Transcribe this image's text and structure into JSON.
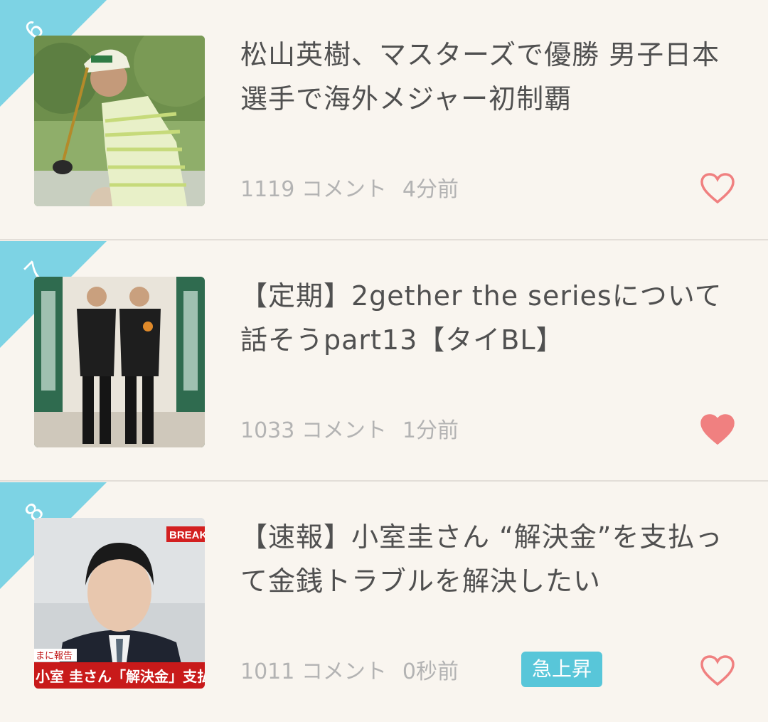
{
  "colors": {
    "accent": "#7dd3e4",
    "heart": "#f08080",
    "badge": "#58c6d9",
    "meta_text": "#b3b3b3",
    "title_text": "#505050"
  },
  "items": [
    {
      "rank": "6",
      "title": "松山英樹、マスターズで優勝 男子日本選手で海外メジャー初制覇",
      "comments": "1119 コメント",
      "time": "4分前",
      "liked": false,
      "thumbnail": "golfer-swing-photo"
    },
    {
      "rank": "7",
      "title": "【定期】2gether the seriesについて話そうpart13【タイBL】",
      "comments": "1033 コメント",
      "time": "1分前",
      "liked": true,
      "thumbnail": "two-men-standing-photo"
    },
    {
      "rank": "8",
      "title": "【速報】小室圭さん “解決金”を支払って金銭トラブルを解決したい",
      "comments": "1011 コメント",
      "time": "0秒前",
      "badge": "急上昇",
      "liked": false,
      "thumbnail": "news-broadcast-photo",
      "thumb_text": {
        "breaking": "BREAK",
        "report": "まに報告",
        "caption": "小室 圭さん「解決金」支払"
      }
    }
  ]
}
